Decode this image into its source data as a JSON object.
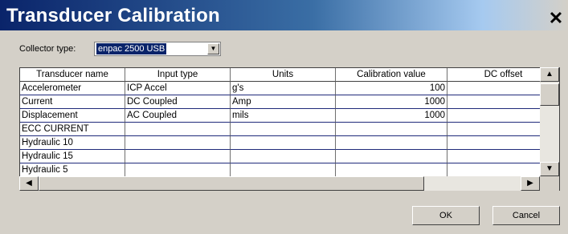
{
  "window": {
    "title": "Transducer Calibration",
    "close_icon": "✕"
  },
  "collector": {
    "label": "Collector type:",
    "value": "enpac 2500 USB"
  },
  "table": {
    "headers": [
      "Transducer name",
      "Input type",
      "Units",
      "Calibration value",
      "DC offset"
    ],
    "rows": [
      [
        "Accelerometer",
        "ICP Accel",
        "g's",
        "100",
        ""
      ],
      [
        "Current",
        "DC Coupled",
        "Amp",
        "1000",
        ""
      ],
      [
        "Displacement",
        "AC Coupled",
        "mils",
        "1000",
        ""
      ],
      [
        "ECC CURRENT",
        "",
        "",
        "",
        ""
      ],
      [
        "Hydraulic 10",
        "",
        "",
        "",
        ""
      ],
      [
        "Hydraulic 15",
        "",
        "",
        "",
        ""
      ],
      [
        "Hydraulic 5",
        "",
        "",
        "",
        ""
      ]
    ]
  },
  "buttons": {
    "ok": "OK",
    "cancel": "Cancel"
  }
}
